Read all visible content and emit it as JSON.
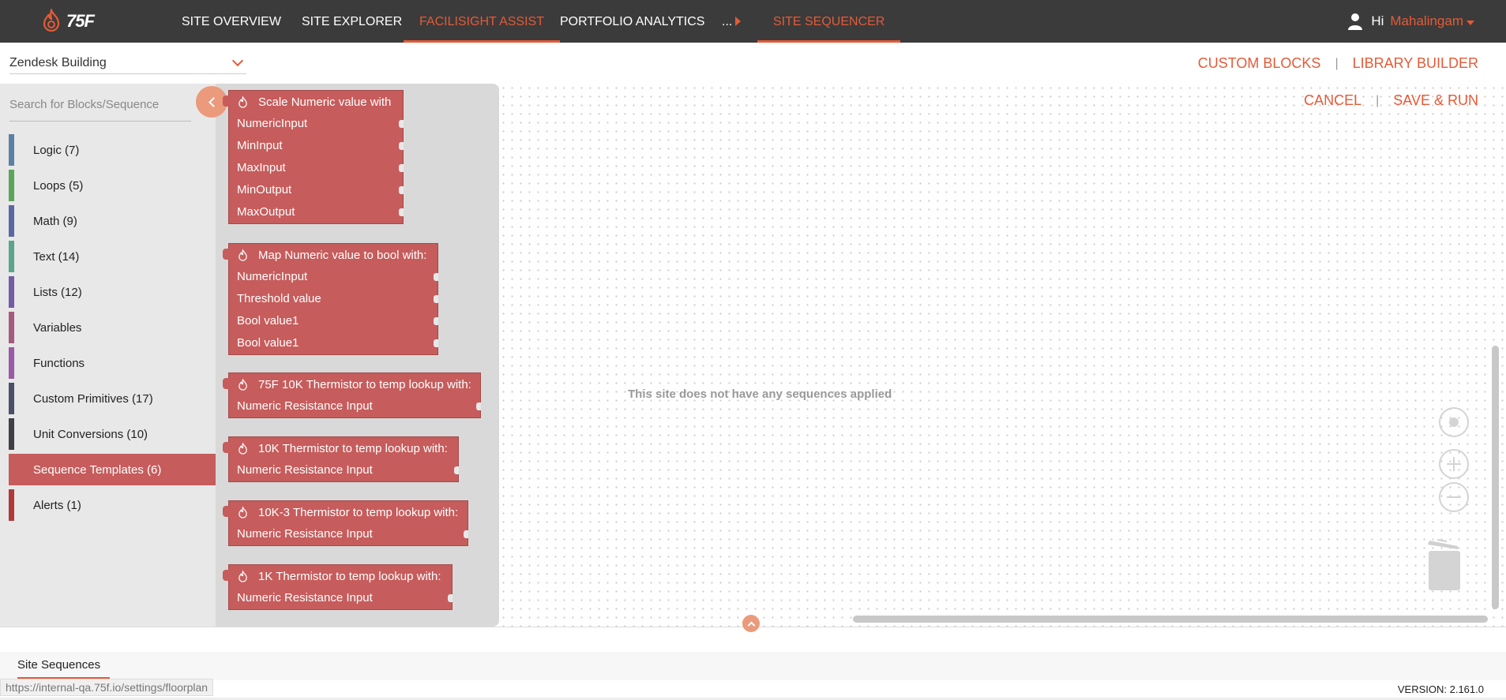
{
  "brand": {
    "logo_text": "75F",
    "accent": "#e55a37"
  },
  "nav": {
    "items": [
      "SITE OVERVIEW",
      "SITE EXPLORER",
      "FACILISIGHT ASSIST",
      "PORTFOLIO ANALYTICS",
      "SITE SEQUENCER"
    ],
    "more": "...",
    "greeting": "Hi",
    "user_name": "Mahalingam"
  },
  "building": {
    "selected": "Zendesk Building"
  },
  "links": {
    "custom_blocks": "CUSTOM BLOCKS",
    "library_builder": "LIBRARY BUILDER",
    "cancel": "CANCEL",
    "save_run": "SAVE & RUN",
    "sep": "|"
  },
  "search": {
    "placeholder": "Search for Blocks/Sequence"
  },
  "categories": [
    {
      "label": "Logic (7)",
      "color": "#5b80a5"
    },
    {
      "label": "Loops (5)",
      "color": "#5ba55b"
    },
    {
      "label": "Math (9)",
      "color": "#5b67a5"
    },
    {
      "label": "Text (14)",
      "color": "#5ba58c"
    },
    {
      "label": "Lists (12)",
      "color": "#745ba5"
    },
    {
      "label": "Variables",
      "color": "#a55b80"
    },
    {
      "label": "Functions",
      "color": "#995ba5"
    },
    {
      "label": "Custom Primitives (17)",
      "color": "#4a4f6a"
    },
    {
      "label": "Unit Conversions (10)",
      "color": "#3f3f45"
    },
    {
      "label": "Sequence Templates (6)",
      "color": "#c65c5c"
    },
    {
      "label": "Alerts (1)",
      "color": "#b03a3a"
    }
  ],
  "blocks": [
    {
      "title": "Scale Numeric value with",
      "inputs": [
        "NumericInput",
        "MinInput",
        "MaxInput",
        "MinOutput",
        "MaxOutput"
      ]
    },
    {
      "title": "Map Numeric value to bool with:",
      "inputs": [
        "NumericInput",
        "Threshold value",
        "Bool value1",
        "Bool value1"
      ]
    },
    {
      "title": "75F 10K Thermistor to temp lookup with:",
      "inputs": [
        "Numeric Resistance Input"
      ]
    },
    {
      "title": "10K Thermistor to temp lookup with:",
      "inputs": [
        "Numeric Resistance Input"
      ]
    },
    {
      "title": "10K-3 Thermistor to temp lookup with:",
      "inputs": [
        "Numeric Resistance Input"
      ]
    },
    {
      "title": "1K Thermistor to temp lookup with:",
      "inputs": [
        "Numeric Resistance Input"
      ]
    }
  ],
  "canvas": {
    "empty_message": "This site does not have any sequences applied"
  },
  "footer": {
    "tab": "Site Sequences",
    "status_url": "https://internal-qa.75f.io/settings/floorplan",
    "version": "VERSION: 2.161.0"
  }
}
